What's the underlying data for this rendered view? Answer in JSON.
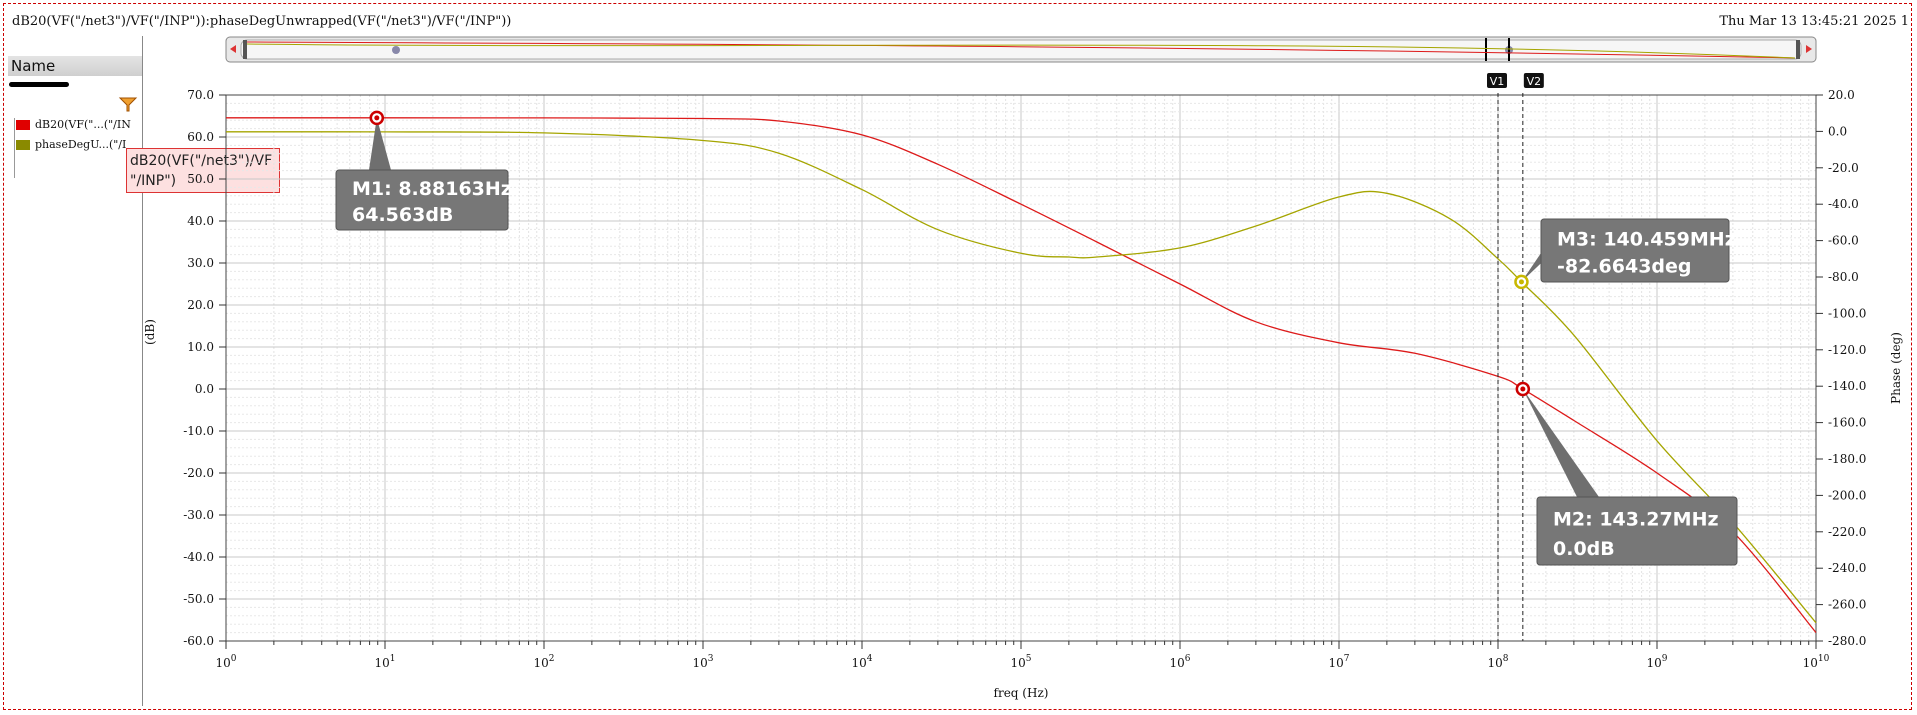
{
  "window": {
    "title": "dB20(VF(\"/net3\")/VF(\"/INP\")):phaseDegUnwrapped(VF(\"/net3\")/VF(\"/INP\"))",
    "timestamp": "Thu Mar 13 13:45:21 2025  1"
  },
  "sidebar": {
    "header": "Name",
    "items": [
      {
        "label": "dB20(VF(\"...(\"/IN",
        "color": "#e00000"
      },
      {
        "label": "phaseDegU...(\"/I",
        "color": "#8a8a00"
      }
    ],
    "tooltip_line1": "dB20(VF(\"/net3\")/VF",
    "tooltip_line2": "\"/INP\")"
  },
  "colors": {
    "db": "#dd1a1a",
    "phase": "#a5a500",
    "marker_label_bg": "#777777"
  },
  "chart_data": {
    "type": "line",
    "xscale": "log",
    "xlim": [
      1,
      10000000000
    ],
    "xlabel": "freq (Hz)",
    "x_tick_bases": [
      "10",
      "10",
      "10",
      "10",
      "10",
      "10",
      "10",
      "10",
      "10",
      "10",
      "10"
    ],
    "x_tick_exps": [
      "0",
      "1",
      "2",
      "3",
      "4",
      "5",
      "6",
      "7",
      "8",
      "9",
      "10"
    ],
    "ylabel_left": "(dB)",
    "ylim_left": [
      -60,
      70
    ],
    "yticks_left": [
      "70.0",
      "60.0",
      "50.0",
      "40.0",
      "30.0",
      "20.0",
      "10.0",
      "0.0",
      "-10.0",
      "-20.0",
      "-30.0",
      "-40.0",
      "-50.0",
      "-60.0"
    ],
    "ylabel_right": "Phase (deg)",
    "ylim_right": [
      -280,
      20
    ],
    "yticks_right": [
      "20.0",
      "0.0",
      "-20.0",
      "-40.0",
      "-60.0",
      "-80.0",
      "-100.0",
      "-120.0",
      "-140.0",
      "-160.0",
      "-180.0",
      "-200.0",
      "-220.0",
      "-240.0",
      "-260.0",
      "-280.0"
    ],
    "grid": true,
    "series": [
      {
        "name": "dB20(VF(\"/net3\")/VF(\"/INP\"))",
        "axis": "left",
        "x": [
          1,
          10,
          100,
          1000,
          3000,
          10000,
          30000,
          100000,
          300000,
          1000000,
          3000000,
          10000000,
          30000000,
          100000000,
          143270000,
          300000000,
          1000000000,
          3000000000,
          10000000000
        ],
        "y": [
          64.56,
          64.56,
          64.55,
          64.4,
          63.8,
          60.5,
          53.5,
          44.0,
          35.0,
          25.0,
          16.0,
          11.0,
          8.5,
          3.0,
          0.0,
          -7.5,
          -20.0,
          -34.0,
          -58.0
        ]
      },
      {
        "name": "phaseDegUnwrapped(VF(\"/net3\")/VF(\"/INP\"))",
        "axis": "right",
        "x": [
          1,
          10,
          100,
          1000,
          3000,
          10000,
          30000,
          100000,
          200000,
          300000,
          1000000,
          3000000,
          10000000,
          20000000,
          50000000,
          100000000,
          140459000,
          300000000,
          1000000000,
          3000000000,
          10000000000
        ],
        "y": [
          -0.2,
          -0.3,
          -0.8,
          -5.0,
          -12.0,
          -32.0,
          -54.0,
          -67.0,
          -69.0,
          -69.0,
          -64.0,
          -52.0,
          -36.0,
          -34.0,
          -48.0,
          -70.0,
          -82.66,
          -112.0,
          -170.0,
          -215.0,
          -270.0
        ]
      }
    ],
    "cursors": [
      "V1",
      "V2"
    ],
    "cursor_x": [
      100000000,
      143270000
    ],
    "markers": [
      {
        "name": "M1",
        "series": 0,
        "x": 8.88163,
        "y": 64.563,
        "line1": "M1: 8.88163Hz",
        "line2": "64.563dB"
      },
      {
        "name": "M2",
        "series": 0,
        "x": 143270000,
        "y": 0.0,
        "line1": "M2: 143.27MHz",
        "line2": "0.0dB"
      },
      {
        "name": "M3",
        "series": 1,
        "x": 140459000,
        "y": -82.6643,
        "line1": "M3: 140.459MHz",
        "line2": "-82.6643deg"
      }
    ]
  }
}
